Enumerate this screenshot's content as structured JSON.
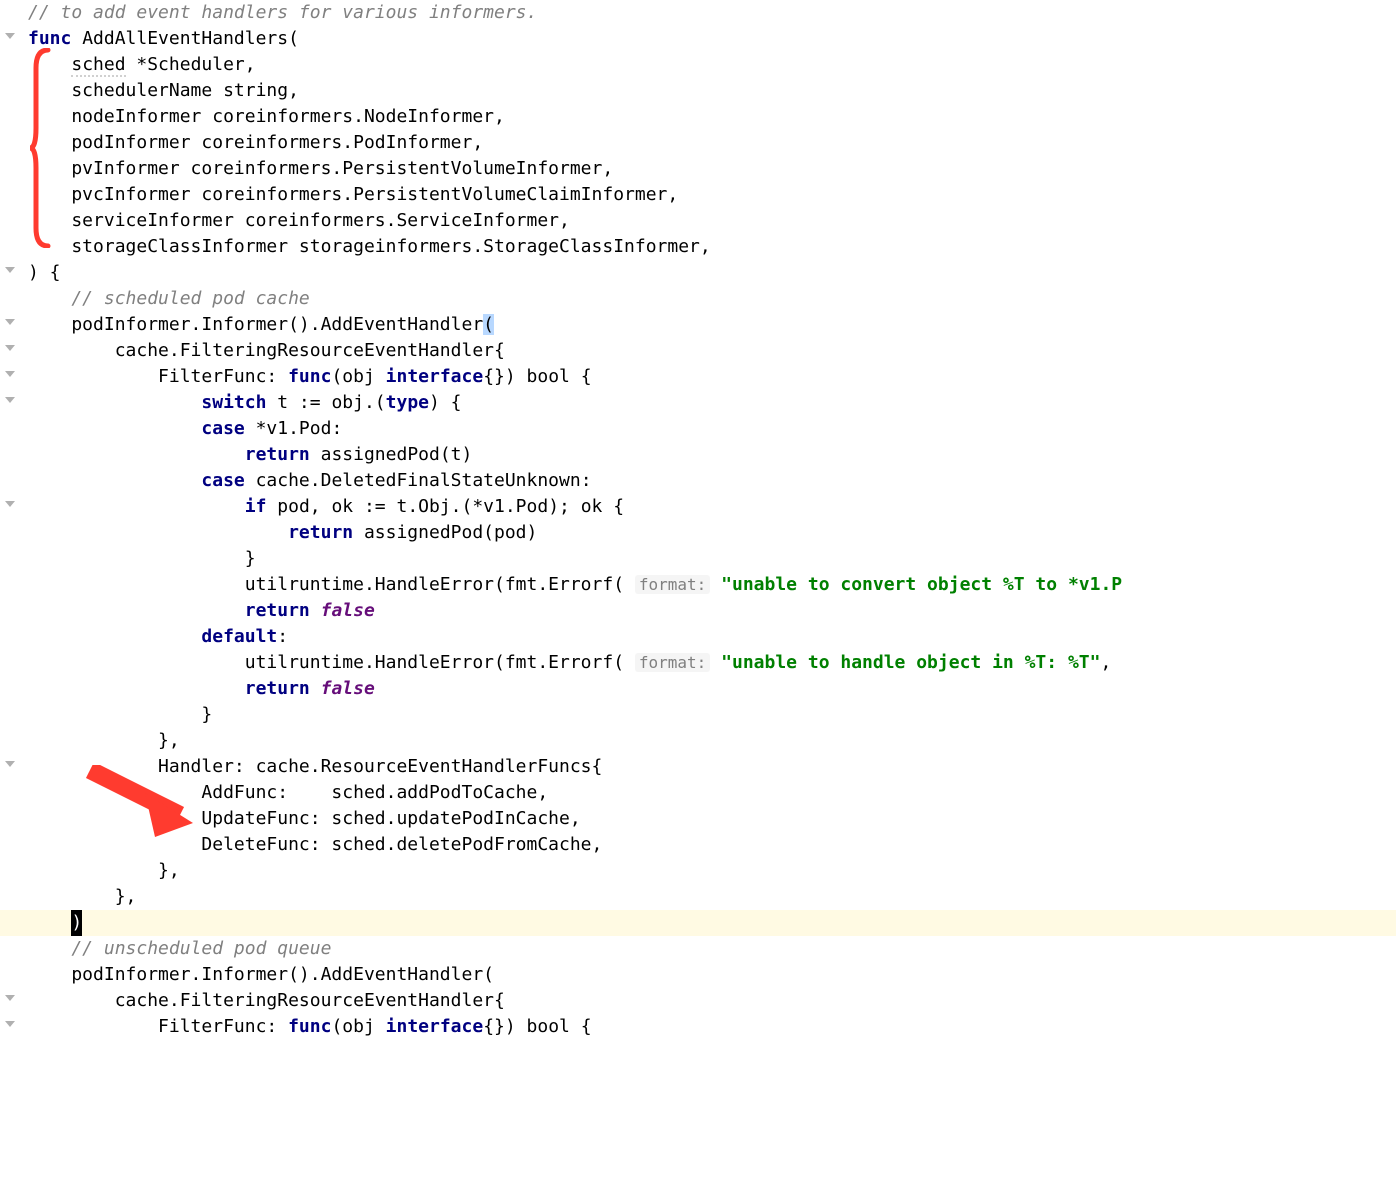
{
  "code": {
    "l01": "// to add event handlers for various informers.",
    "l02_func": "func",
    "l02_rest": " AddAllEventHandlers(",
    "l03_indent": "    ",
    "l03_name": "sched",
    "l03_rest": " *Scheduler,",
    "l04": "    schedulerName string,",
    "l05": "    nodeInformer coreinformers.NodeInformer,",
    "l06": "    podInformer coreinformers.PodInformer,",
    "l07": "    pvInformer coreinformers.PersistentVolumeInformer,",
    "l08": "    pvcInformer coreinformers.PersistentVolumeClaimInformer,",
    "l09": "    serviceInformer coreinformers.ServiceInformer,",
    "l10": "    storageClassInformer storageinformers.StorageClassInformer,",
    "l11": ") {",
    "l12_comment": "    // scheduled pod cache",
    "l13_a": "    podInformer.Informer().AddEventHandler",
    "l13_paren": "(",
    "l14": "        cache.FilteringResourceEventHandler{",
    "l15_a": "            FilterFunc: ",
    "l15_func": "func",
    "l15_b": "(obj ",
    "l15_interface": "interface",
    "l15_c": "{}) bool {",
    "l16_a": "                ",
    "l16_switch": "switch",
    "l16_b": " t := obj.(",
    "l16_type": "type",
    "l16_c": ") {",
    "l17_a": "                ",
    "l17_case": "case",
    "l17_b": " *v1.Pod:",
    "l18_a": "                    ",
    "l18_return": "return",
    "l18_b": " assignedPod(t)",
    "l19_a": "                ",
    "l19_case": "case",
    "l19_b": " cache.DeletedFinalStateUnknown:",
    "l20_a": "                    ",
    "l20_if": "if",
    "l20_b": " pod, ok := t.Obj.(*v1.Pod); ok {",
    "l21_a": "                        ",
    "l21_return": "return",
    "l21_b": " assignedPod(pod)",
    "l22": "                    }",
    "l23_a": "                    utilruntime.HandleError(fmt.Errorf( ",
    "l23_hint": "format:",
    "l23_sp": " ",
    "l23_str": "\"unable to convert object %T to *v1.P",
    "l24_a": "                    ",
    "l24_return": "return",
    "l24_sp": " ",
    "l24_false": "false",
    "l25_a": "                ",
    "l25_default": "default",
    "l25_b": ":",
    "l26_a": "                    utilruntime.HandleError(fmt.Errorf( ",
    "l26_hint": "format:",
    "l26_sp": " ",
    "l26_str": "\"unable to handle object in %T: %T\"",
    "l26_b": ",",
    "l27_a": "                    ",
    "l27_return": "return",
    "l27_sp": " ",
    "l27_false": "false",
    "l28": "                }",
    "l29": "            },",
    "l30": "            Handler: cache.ResourceEventHandlerFuncs{",
    "l31": "                AddFunc:    sched.addPodToCache,",
    "l32": "                UpdateFunc: sched.updatePodInCache,",
    "l33": "                DeleteFunc: sched.deletePodFromCache,",
    "l34": "            },",
    "l35": "        },",
    "l36_caret": ")",
    "l37_comment": "    // unscheduled pod queue",
    "l38": "    podInformer.Informer().AddEventHandler(",
    "l39": "        cache.FilteringResourceEventHandler{",
    "l40_a": "            FilterFunc: ",
    "l40_func": "func",
    "l40_b": "(obj ",
    "l40_interface": "interface",
    "l40_c": "{}) bool {"
  }
}
